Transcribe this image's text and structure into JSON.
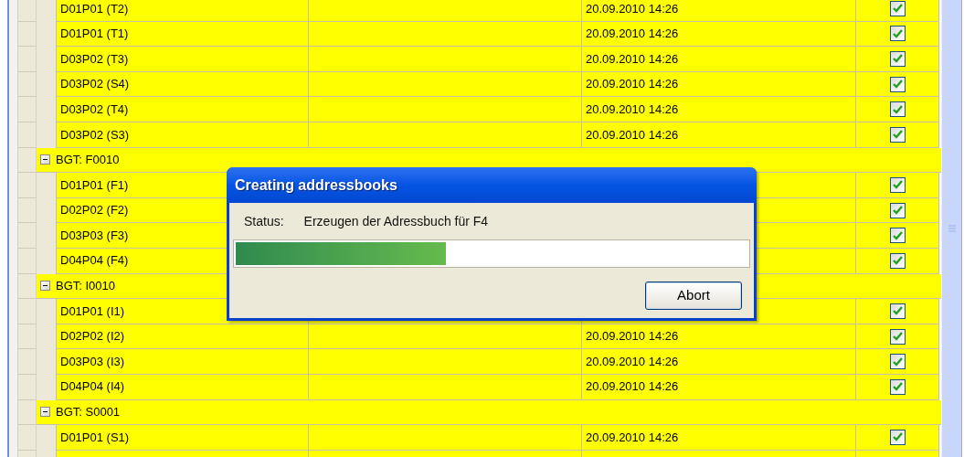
{
  "groups": [
    {
      "rows": [
        {
          "name": "D01P01 (T2)",
          "date": "20.09.2010 14:26",
          "checked": true
        },
        {
          "name": "D01P01 (T1)",
          "date": "20.09.2010 14:26",
          "checked": true
        },
        {
          "name": "D03P02 (T3)",
          "date": "20.09.2010 14:26",
          "checked": true
        },
        {
          "name": "D03P02 (S4)",
          "date": "20.09.2010 14:26",
          "checked": true
        },
        {
          "name": "D03P02 (T4)",
          "date": "20.09.2010 14:26",
          "checked": true
        },
        {
          "name": "D03P02 (S3)",
          "date": "20.09.2010 14:26",
          "checked": true
        }
      ]
    },
    {
      "label": "BGT: F0010",
      "expanded": true,
      "rows": [
        {
          "name": "D01P01 (F1)",
          "checked": true
        },
        {
          "name": "D02P02 (F2)",
          "checked": true
        },
        {
          "name": "D03P03 (F3)",
          "checked": true
        },
        {
          "name": "D04P04 (F4)",
          "checked": true
        }
      ]
    },
    {
      "label": "BGT: I0010",
      "expanded": true,
      "rows": [
        {
          "name": "D01P01 (I1)",
          "checked": true
        },
        {
          "name": "D02P02 (I2)",
          "date": "20.09.2010 14:26",
          "checked": true
        },
        {
          "name": "D03P03 (I3)",
          "date": "20.09.2010 14:26",
          "checked": true
        },
        {
          "name": "D04P04 (I4)",
          "date": "20.09.2010 14:26",
          "checked": true
        }
      ]
    },
    {
      "label": "BGT: S0001",
      "expanded": true,
      "rows": [
        {
          "name": "D01P01 (S1)",
          "date": "20.09.2010 14:26",
          "checked": true
        },
        {}
      ]
    }
  ],
  "dialog": {
    "title": "Creating addressbooks",
    "status_label": "Status:",
    "status_text": "Erzeugen der Adressbuch für F4",
    "progress": {
      "level": 0.41
    },
    "button": "Abort"
  }
}
